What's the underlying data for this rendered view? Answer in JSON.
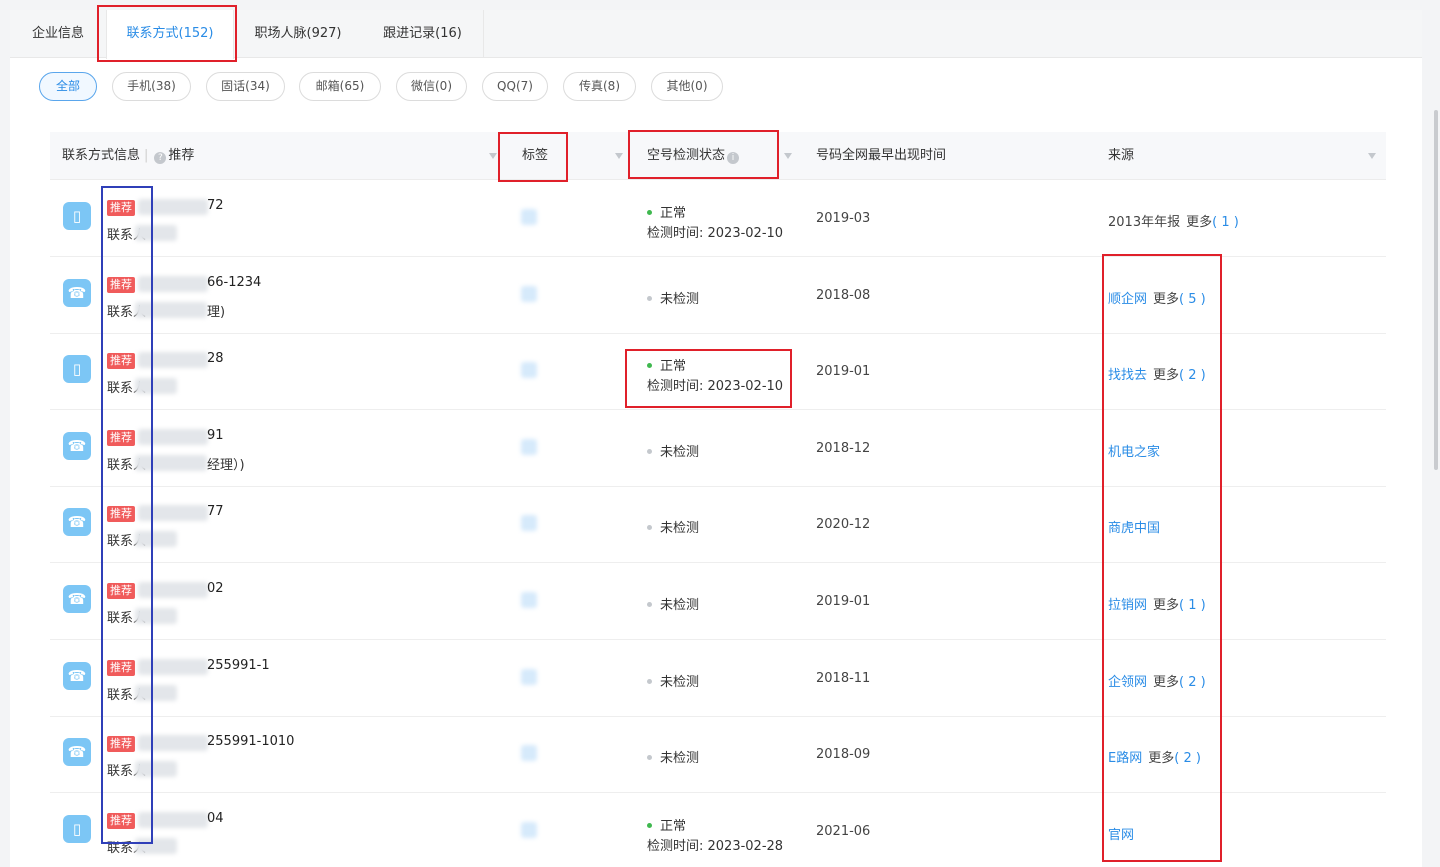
{
  "tabs": [
    {
      "label": "企业信息",
      "active": false
    },
    {
      "label": "联系方式(152)",
      "active": true
    },
    {
      "label": "职场人脉(927)",
      "active": false
    },
    {
      "label": "跟进记录(16)",
      "active": false
    }
  ],
  "filters": [
    {
      "label": "全部",
      "active": true
    },
    {
      "label": "手机(38)",
      "active": false
    },
    {
      "label": "固话(34)",
      "active": false
    },
    {
      "label": "邮箱(65)",
      "active": false
    },
    {
      "label": "微信(0)",
      "active": false
    },
    {
      "label": "QQ(7)",
      "active": false
    },
    {
      "label": "传真(8)",
      "active": false
    },
    {
      "label": "其他(0)",
      "active": false
    }
  ],
  "header": {
    "col1": "联系方式信息",
    "col1_sep": "|",
    "col1_info_icon": "?",
    "col1_recommend": "推荐",
    "col2": "标签",
    "col3": "空号检测状态",
    "col3_info_icon": "i",
    "col4": "号码全网最早出现时间",
    "col5": "来源"
  },
  "rows": [
    {
      "icon": "mobile-icon",
      "badge": "推荐",
      "number_tail": "72",
      "contact_label": "联系人",
      "contact_tail": "",
      "status": "正常",
      "status_ok": true,
      "check_time": "检测时间: 2023-02-10",
      "first_seen": "2019-03",
      "source": "2013年年报",
      "source_link": false,
      "more": "更多",
      "more_count": "( 1 )"
    },
    {
      "icon": "phone-icon",
      "badge": "推荐",
      "number_tail": "66-1234",
      "contact_label": "联系人",
      "contact_tail": "理)",
      "status": "未检测",
      "status_ok": false,
      "check_time": "",
      "first_seen": "2018-08",
      "source": "顺企网",
      "source_link": true,
      "more": "更多",
      "more_count": "( 5 )"
    },
    {
      "icon": "mobile-icon",
      "badge": "推荐",
      "number_tail": "28",
      "contact_label": "联系人",
      "contact_tail": "",
      "status": "正常",
      "status_ok": true,
      "check_time": "检测时间: 2023-02-10",
      "first_seen": "2019-01",
      "source": "找找去",
      "source_link": true,
      "more": "更多",
      "more_count": "( 2 )"
    },
    {
      "icon": "phone-icon",
      "badge": "推荐",
      "number_tail": "91",
      "contact_label": "联系人",
      "contact_tail": "经理）)",
      "status": "未检测",
      "status_ok": false,
      "check_time": "",
      "first_seen": "2018-12",
      "source": "机电之家",
      "source_link": true,
      "more": "",
      "more_count": ""
    },
    {
      "icon": "phone-icon",
      "badge": "推荐",
      "number_tail": "77",
      "contact_label": "联系人",
      "contact_tail": "",
      "status": "未检测",
      "status_ok": false,
      "check_time": "",
      "first_seen": "2020-12",
      "source": "商虎中国",
      "source_link": true,
      "more": "",
      "more_count": ""
    },
    {
      "icon": "phone-icon",
      "badge": "推荐",
      "number_tail": "02",
      "contact_label": "联系人",
      "contact_tail": "",
      "status": "未检测",
      "status_ok": false,
      "check_time": "",
      "first_seen": "2019-01",
      "source": "拉销网",
      "source_link": true,
      "more": "更多",
      "more_count": "( 1 )"
    },
    {
      "icon": "phone-icon",
      "badge": "推荐",
      "number_tail": "255991-1",
      "contact_label": "联系人",
      "contact_tail": "",
      "status": "未检测",
      "status_ok": false,
      "check_time": "",
      "first_seen": "2018-11",
      "source": "企领网",
      "source_link": true,
      "more": "更多",
      "more_count": "( 2 )"
    },
    {
      "icon": "phone-icon",
      "badge": "推荐",
      "number_tail": "255991-1010",
      "contact_label": "联系人",
      "contact_tail": "",
      "status": "未检测",
      "status_ok": false,
      "check_time": "",
      "first_seen": "2018-09",
      "source": "E路网",
      "source_link": true,
      "more": "更多",
      "more_count": "( 2 )"
    },
    {
      "icon": "mobile-icon",
      "badge": "推荐",
      "number_tail": "04",
      "contact_label": "联系人",
      "contact_tail": "",
      "status": "正常",
      "status_ok": true,
      "check_time": "检测时间: 2023-02-28",
      "first_seen": "2021-06",
      "source": "官网",
      "source_link": true,
      "more": "",
      "more_count": ""
    }
  ],
  "icons": {
    "mobile-icon": "▯",
    "phone-icon": "☎"
  },
  "colors": {
    "accent": "#2a8ce6",
    "badge": "#f05b5b",
    "annotation_red": "#e0202a",
    "annotation_blue": "#2f3fb8",
    "ok": "#3fb84f"
  }
}
